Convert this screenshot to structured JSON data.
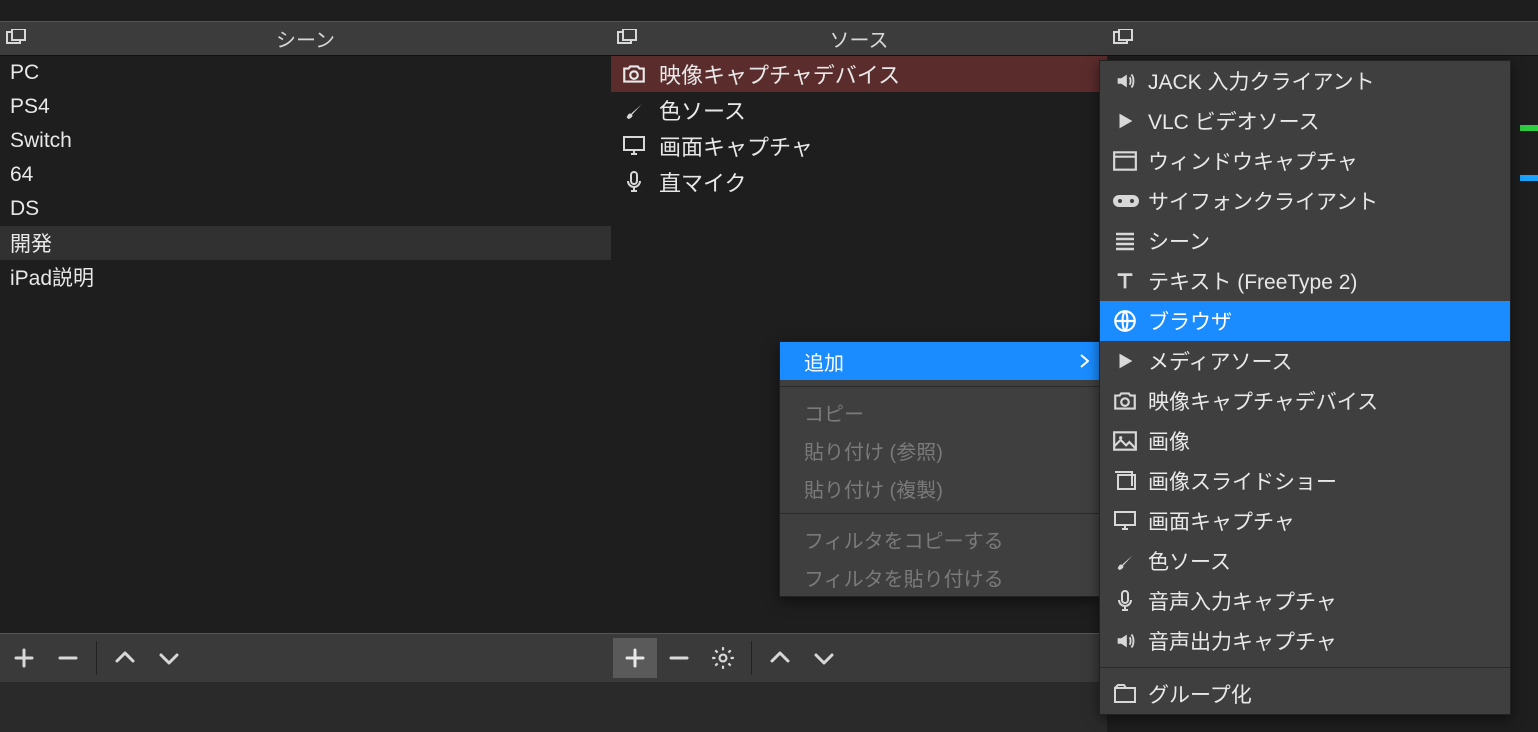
{
  "panels": {
    "scenes": {
      "title": "シーン",
      "items": [
        {
          "label": "PC",
          "selected": false
        },
        {
          "label": "PS4",
          "selected": false
        },
        {
          "label": "Switch",
          "selected": false
        },
        {
          "label": "64",
          "selected": false
        },
        {
          "label": "DS",
          "selected": false
        },
        {
          "label": "開発",
          "selected": true
        },
        {
          "label": "iPad説明",
          "selected": false
        }
      ]
    },
    "sources": {
      "title": "ソース",
      "items": [
        {
          "icon": "camera-icon",
          "label": "映像キャプチャデバイス",
          "selected": true
        },
        {
          "icon": "brush-icon",
          "label": "色ソース",
          "selected": false
        },
        {
          "icon": "monitor-icon",
          "label": "画面キャプチャ",
          "selected": false
        },
        {
          "icon": "mic-icon",
          "label": "直マイク",
          "selected": false
        }
      ]
    },
    "mixer": {
      "title": ""
    }
  },
  "context_menu": {
    "items": [
      {
        "label": "追加",
        "has_submenu": true,
        "highlight": true,
        "disabled": false
      },
      {
        "sep": true
      },
      {
        "label": "コピー",
        "disabled": true
      },
      {
        "label": "貼り付け (参照)",
        "disabled": true
      },
      {
        "label": "貼り付け (複製)",
        "disabled": true
      },
      {
        "sep": true
      },
      {
        "label": "フィルタをコピーする",
        "disabled": true
      },
      {
        "label": "フィルタを貼り付ける",
        "disabled": true
      }
    ]
  },
  "submenu": {
    "items": [
      {
        "icon": "speaker-icon",
        "label": "JACK 入力クライアント"
      },
      {
        "icon": "play-icon",
        "label": "VLC ビデオソース"
      },
      {
        "icon": "window-icon",
        "label": "ウィンドウキャプチャ"
      },
      {
        "icon": "gamepad-icon",
        "label": "サイフォンクライアント"
      },
      {
        "icon": "list-icon",
        "label": "シーン"
      },
      {
        "icon": "text-icon",
        "label": "テキスト (FreeType 2)"
      },
      {
        "icon": "globe-icon",
        "label": "ブラウザ",
        "highlight": true
      },
      {
        "icon": "play-icon",
        "label": "メディアソース"
      },
      {
        "icon": "camera-icon",
        "label": "映像キャプチャデバイス"
      },
      {
        "icon": "image-icon",
        "label": "画像"
      },
      {
        "icon": "slideshow-icon",
        "label": "画像スライドショー"
      },
      {
        "icon": "monitor-icon",
        "label": "画面キャプチャ"
      },
      {
        "icon": "brush-icon",
        "label": "色ソース"
      },
      {
        "icon": "mic-icon",
        "label": "音声入力キャプチャ"
      },
      {
        "icon": "speaker-icon",
        "label": "音声出力キャプチャ"
      },
      {
        "sep": true
      },
      {
        "icon": "group-icon",
        "label": "グループ化"
      }
    ]
  },
  "icons": {
    "plus": "+",
    "minus": "−"
  }
}
